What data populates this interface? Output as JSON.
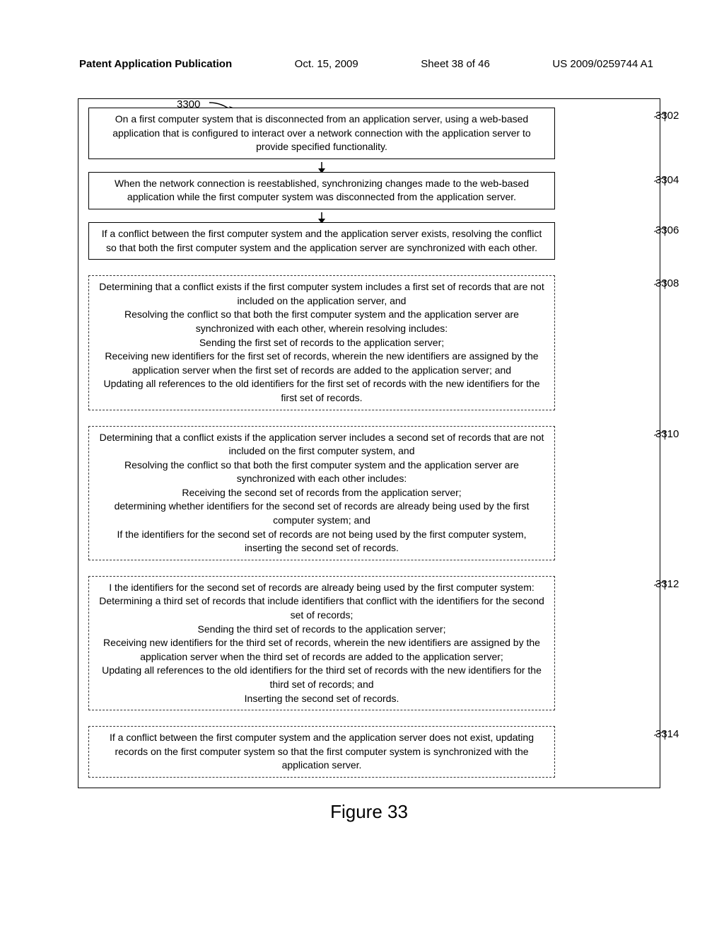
{
  "header": {
    "publication_label": "Patent Application Publication",
    "date": "Oct. 15, 2009",
    "sheet": "Sheet 38 of 46",
    "pub_number": "US 2009/0259744 A1"
  },
  "figure": {
    "number_label": "3300",
    "caption": "Figure 33",
    "steps": [
      {
        "label": "3302",
        "dashed": false,
        "arrow_after": true,
        "text": "On a first computer system that is disconnected from an application server, using a web-based application that is configured to interact over a network connection with the application server to provide specified functionality."
      },
      {
        "label": "3304",
        "dashed": false,
        "arrow_after": true,
        "text": "When the network connection is reestablished, synchronizing changes made to the web-based application while the first computer system was disconnected from the application server."
      },
      {
        "label": "3306",
        "dashed": false,
        "arrow_after": false,
        "text": "If a conflict between the first computer system and the application server exists, resolving the conflict so that both the first computer system and the application server are synchronized with each other."
      },
      {
        "label": "3308",
        "dashed": true,
        "arrow_after": false,
        "text": "Determining that a conflict exists if the first computer system includes a first set of records that are not included on the application server, and\nResolving the conflict so that both the first computer system and the application server are synchronized with each other, wherein resolving includes:\nSending the first set of records to the application server;\nReceiving new identifiers for the first set of records, wherein the new identifiers are assigned by the application server when the first set of records are added to the application server; and\nUpdating all references to the old identifiers for the first set of records with the new identifiers for the first set of records."
      },
      {
        "label": "3310",
        "dashed": true,
        "arrow_after": false,
        "text": "Determining that a conflict exists if the application server includes a second set of records that are not included on the first computer system, and\nResolving the conflict so that both the first computer system and the application server are synchronized with each other includes:\nReceiving the second set of records from the application server;\ndetermining whether identifiers for the second set of records are already being used by the first computer system; and\nIf the identifiers for the second set of records are not being used by the first computer system, inserting the second set of records."
      },
      {
        "label": "3312",
        "dashed": true,
        "arrow_after": false,
        "text": "I the identifiers for the second set of records are already being used by the first computer system:\nDetermining a third set of records that include identifiers that conflict with the identifiers for the second set of records;\nSending the third set of records to the application server;\nReceiving new identifiers for the third set of records, wherein the new identifiers are assigned by the application server when the third set of records are added to the application server;\nUpdating all references to the old identifiers for the third set of records with the new identifiers for the third set of records; and\nInserting the second set of records."
      },
      {
        "label": "3314",
        "dashed": true,
        "arrow_after": false,
        "text": "If a conflict between the first computer system and the application server does not exist, updating records on the first computer system so that the first computer system is synchronized with the application server."
      }
    ]
  }
}
